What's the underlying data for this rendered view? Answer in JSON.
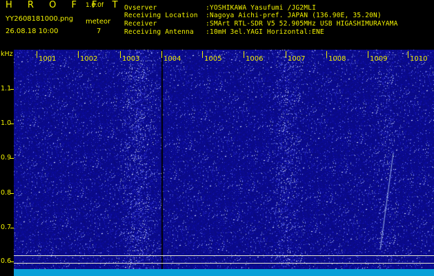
{
  "header": {
    "app_title": "H R O F F T",
    "version": "1.0.0f",
    "filename": "YY2608181000.png",
    "datetime": "26.08.18 10:00",
    "meteor_label": "meteor",
    "meteor_count": "7",
    "info": [
      {
        "key": "Ovserver",
        "value": ":YOSHIKAWA Yasufumi /JG2MLI"
      },
      {
        "key": "Receiving Location",
        "value": ":Nagoya Aichi-pref. JAPAN (136.90E, 35.20N)"
      },
      {
        "key": "Receiver",
        "value": ":SMArt RTL-SDR V5 52.905MHz USB HIGASHIMURAYAMA"
      },
      {
        "key": "Receiving Antenna",
        "value": ":10mH 3el.YAGI Horizontal:ENE"
      }
    ]
  },
  "y_axis": {
    "unit": "kHz",
    "ticks": [
      "1.1",
      "1.0",
      "0.9",
      "0.8",
      "0.7",
      "0.6"
    ]
  },
  "x_axis": {
    "labels": [
      "1001",
      "1002",
      "1003",
      "1004",
      "1005",
      "1006",
      "1007",
      "1008",
      "1009",
      "1010"
    ]
  },
  "colors": {
    "text": "#f2f200",
    "background": "#000000",
    "spectrum_base": "#0a0a8c",
    "noise_floor": "#0aa0d8"
  }
}
